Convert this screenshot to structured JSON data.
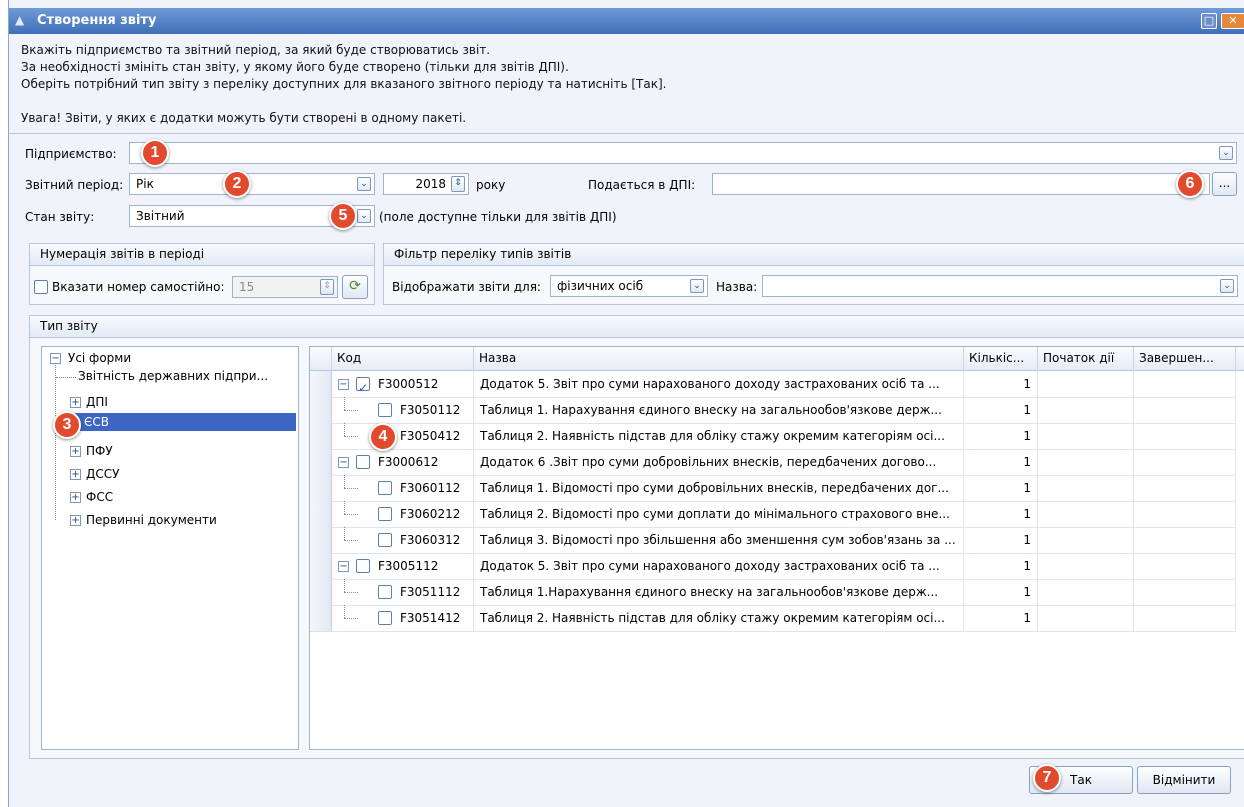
{
  "window": {
    "title": "Створення звіту"
  },
  "info": {
    "line1": "Вкажіть підприємство та звітний період, за який буде створюватись звіт.",
    "line2": "За необхідності змініть стан звіту, у якому його буде створено (тільки для звітів ДПІ).",
    "line3": "Оберіть потрібний тип звіту з переліку доступних для вказаного звітного періоду та натисніть [Так].",
    "line4": "Увага! Звіти, у яких є додатки можуть бути створені в одному пакеті."
  },
  "form": {
    "enterprise_label": "Підприємство:",
    "enterprise_value": "",
    "period_label": "Звітний період:",
    "period_value": "Рік",
    "year_value": "2018",
    "year_suffix": "року",
    "dpi_label": "Подається в ДПІ:",
    "dpi_value": "",
    "dpi_button": "...",
    "state_label": "Стан звіту:",
    "state_value": "Звітний",
    "state_note": "(поле доступне тільки для звітів ДПІ)"
  },
  "numbering": {
    "title": "Нумерація звітів в періоді",
    "checkbox_label": "Вказати номер самостійно:",
    "number_value": "15"
  },
  "filter": {
    "title": "Фільтр переліку типів звітів",
    "show_label": "Відображати звіти для:",
    "show_value": "фізичних осіб",
    "name_label": "Назва:",
    "name_value": ""
  },
  "report_type": {
    "title": "Тип звіту",
    "tree": [
      "Усі форми",
      "Звітність державних підпри...",
      "ДПІ",
      "ЄСВ",
      "ПФУ",
      "ДССУ",
      "ФСС",
      "Первинні документи"
    ]
  },
  "grid": {
    "columns": [
      "Код",
      "Назва",
      "Кількіс...",
      "Початок дії",
      "Завершен..."
    ],
    "rows": [
      {
        "code": "F3000512",
        "name": "Додаток 5. Звіт про суми нарахованого доходу застрахованих осіб та ...",
        "count": "1",
        "checked": true,
        "level": 0
      },
      {
        "code": "F3050112",
        "name": "Таблиця 1. Нарахування єдиного внеску на загальнообов'язкове держ...",
        "count": "1",
        "checked": false,
        "level": 1
      },
      {
        "code": "F3050412",
        "name": "Таблиця 2. Наявність підстав для обліку стажу окремим категоріям осі...",
        "count": "1",
        "checked": false,
        "level": 1
      },
      {
        "code": "F3000612",
        "name": "Додаток 6 .Звіт про суми добровільних внесків, передбачених догово...",
        "count": "1",
        "checked": false,
        "level": 0
      },
      {
        "code": "F3060112",
        "name": "Таблиця 1. Відомості про суми добровільних внесків, передбачених дог...",
        "count": "1",
        "checked": false,
        "level": 1
      },
      {
        "code": "F3060212",
        "name": "Таблиця 2. Відомості про суми доплати до мінімального страхового вне...",
        "count": "1",
        "checked": false,
        "level": 1
      },
      {
        "code": "F3060312",
        "name": "Таблиця 3. Відомості про збільшення або зменшення сум зобов'язань за ...",
        "count": "1",
        "checked": false,
        "level": 1
      },
      {
        "code": "F3005112",
        "name": "Додаток 5. Звіт про суми нарахованого доходу застрахованих осіб та ...",
        "count": "1",
        "checked": false,
        "level": 0
      },
      {
        "code": "F3051112",
        "name": "Таблиця 1.Нарахування єдиного внеску на загальнообов'язкове держ...",
        "count": "1",
        "checked": false,
        "level": 1
      },
      {
        "code": "F3051412",
        "name": "Таблиця 2. Наявність підстав для обліку стажу окремим категоріям осі...",
        "count": "1",
        "checked": false,
        "level": 1
      }
    ]
  },
  "buttons": {
    "ok": "Так",
    "cancel": "Відмінити"
  },
  "badges": [
    "1",
    "2",
    "3",
    "4",
    "5",
    "6",
    "7"
  ],
  "colors": {
    "title_bar": "#3f6fb8",
    "badge": "#e24a2e",
    "selection": "#3d66c4"
  }
}
